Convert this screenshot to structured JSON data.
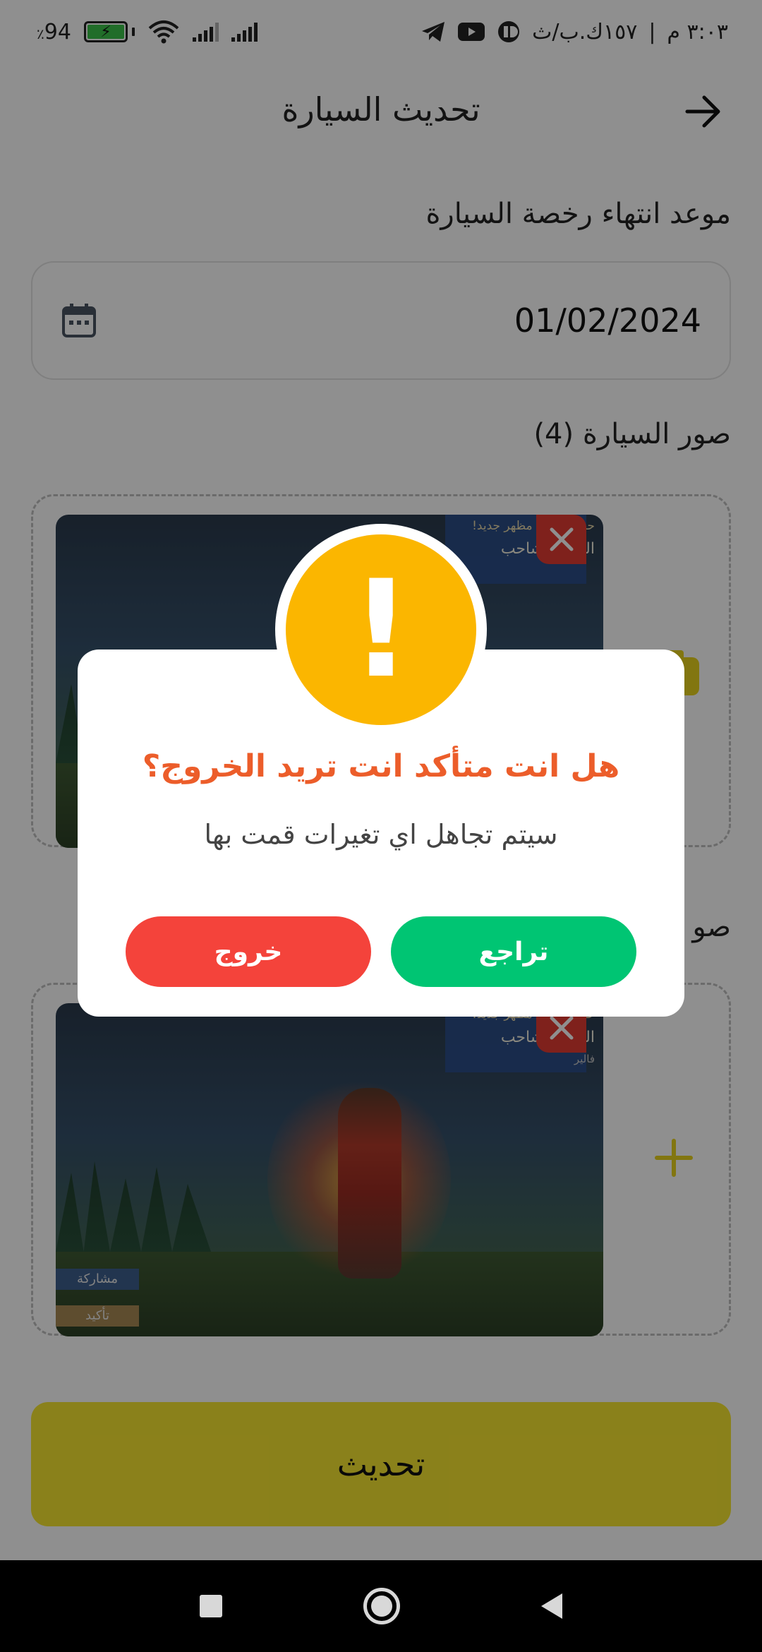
{
  "status_bar": {
    "time": "٣:٠٣ م",
    "network_speed": "١٥٧ك.ب/ث",
    "battery": "94",
    "battery_unit": "٪"
  },
  "header": {
    "title": "تحديث السيارة"
  },
  "form": {
    "license_expiry_label": "موعد انتهاء رخصة السيارة",
    "license_expiry_value": "01/02/2024",
    "car_photos_label": "صور السيارة (4)",
    "second_section_label": "صو",
    "update_button": "تحديث"
  },
  "photo": {
    "banner_top": "حصلت على مظهر جديد!",
    "banner_name": "اللهب الشاحب",
    "banner_sub": "فالير",
    "share_label": "مشاركة",
    "confirm_label": "تأكيد"
  },
  "dialog": {
    "title": "هل انت متأكد انت تريد الخروج؟",
    "message": "سيتم تجاهل اي تغيرات قمت بها",
    "confirm_button": "تراجع",
    "exit_button": "خروج",
    "icon": "warning-exclamation-icon",
    "colors": {
      "title": "#ec5d2a",
      "icon": "#fbb600",
      "confirm": "#00c573",
      "exit": "#f4433b"
    }
  },
  "colors": {
    "update_button": "#f7e630",
    "remove_button": "#e23c32",
    "add_icon": "#e8d31e"
  }
}
